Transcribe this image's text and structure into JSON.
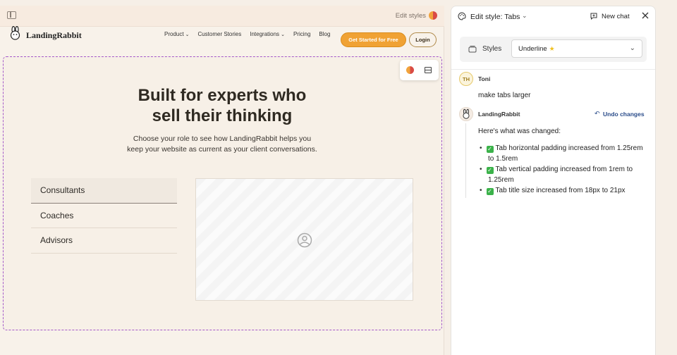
{
  "preview": {
    "edit_styles_label": "Edit styles",
    "icons": {
      "sidebar": "sidebar-toggle-icon",
      "palette": "palette-icon"
    }
  },
  "site": {
    "logo_text": "LandingRabbit",
    "nav": [
      {
        "label": "Product",
        "has_chevron": true
      },
      {
        "label": "Customer Stories",
        "has_chevron": false
      },
      {
        "label": "Integrations",
        "has_chevron": true
      },
      {
        "label": "Pricing",
        "has_chevron": false
      },
      {
        "label": "Blog",
        "has_chevron": false
      }
    ],
    "cta_label": "Get Started for Free",
    "login_label": "Login",
    "hero": {
      "title": "Built for experts who\nsell their thinking",
      "subtitle": "Choose your role to see how LandingRabbit helps you\nkeep your website as current as your client conversations."
    },
    "tabs": [
      {
        "label": "Consultants",
        "active": true
      },
      {
        "label": "Coaches",
        "active": false
      },
      {
        "label": "Advisors",
        "active": false
      }
    ]
  },
  "chat": {
    "title": "Edit style: Tabs",
    "new_chat_label": "New chat",
    "styles_label": "Styles",
    "styles_select_value": "Underline",
    "messages": {
      "user": {
        "initials": "TH",
        "name": "Toni",
        "text": "make tabs larger"
      },
      "bot": {
        "name": "LandingRabbit",
        "undo_label": "Undo changes",
        "intro": "Here's what was changed:",
        "changes": [
          "Tab horizontal padding increased from 1.25rem to 1.5rem",
          "Tab vertical padding increased from 1rem to 1.25rem",
          "Tab title size increased from 18px to 21px"
        ]
      }
    }
  },
  "colors": {
    "cta": "#f0a234",
    "selection_outline": "#a458c9",
    "link": "#2a4c8a",
    "page_bg": "#f8f2ea"
  }
}
